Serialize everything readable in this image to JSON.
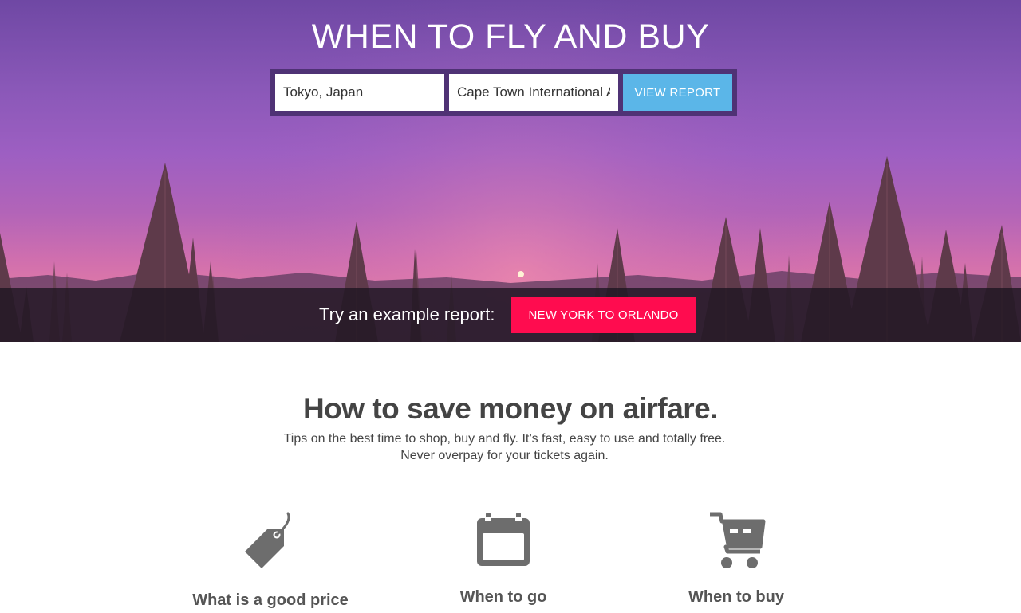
{
  "hero": {
    "title": "WHEN TO FLY AND BUY",
    "origin_value": "Tokyo, Japan",
    "destination_value": "Cape Town International A",
    "view_report_label": "VIEW REPORT",
    "example_label": "Try an example report:",
    "example_button_label": "NEW YORK TO ORLANDO"
  },
  "intro": {
    "title": "How to save money on airfare.",
    "subtitle": "Tips on the best time to shop, buy and fly. It’s fast, easy to use and totally free. Never overpay for your tickets again."
  },
  "features": [
    {
      "icon": "price-tag-icon",
      "label": "What is a good price"
    },
    {
      "icon": "calendar-icon",
      "label": "When to go"
    },
    {
      "icon": "shopping-cart-icon",
      "label": "When to buy"
    }
  ],
  "colors": {
    "view_report_button": "#5bb6e8",
    "example_button": "#ff0c4f",
    "form_frame": "#4f3275",
    "icon_gray": "#6d6d6d",
    "heading_text": "#444444"
  }
}
